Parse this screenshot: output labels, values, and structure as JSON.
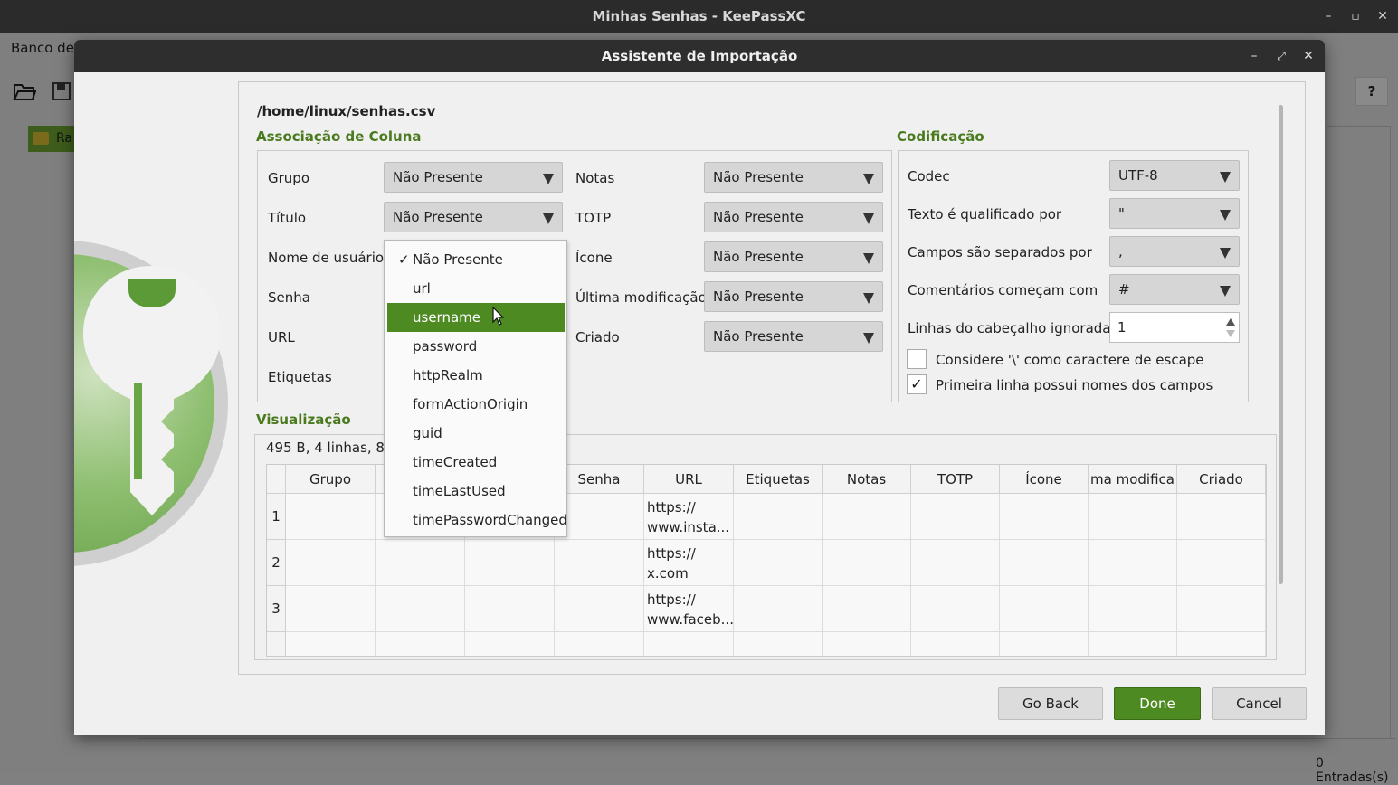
{
  "main_window": {
    "title": "Minhas Senhas - KeePassXC",
    "menu_first": "Banco de",
    "tree_item": "Ra",
    "help": "?",
    "status": "0 Entradas(s)"
  },
  "dialog": {
    "title": "Assistente de Importação",
    "file_path": "/home/linux/senhas.csv",
    "column_section": "Associação de Coluna",
    "encoding_section": "Codificação",
    "preview_section": "Visualização"
  },
  "columns_left": [
    {
      "label": "Grupo",
      "value": "Não Presente"
    },
    {
      "label": "Título",
      "value": "Não Presente"
    },
    {
      "label": "Nome de usuário",
      "value": "Não Presente"
    },
    {
      "label": "Senha",
      "value": ""
    },
    {
      "label": "URL",
      "value": ""
    },
    {
      "label": "Etiquetas",
      "value": ""
    }
  ],
  "columns_right": [
    {
      "label": "Notas",
      "value": "Não Presente"
    },
    {
      "label": "TOTP",
      "value": "Não Presente"
    },
    {
      "label": "Ícone",
      "value": "Não Presente"
    },
    {
      "label": "Última modificação",
      "value": "Não Presente"
    },
    {
      "label": "Criado",
      "value": "Não Presente"
    }
  ],
  "encoding": {
    "codec_label": "Codec",
    "codec_value": "UTF-8",
    "qualifier_label": "Texto é qualificado por",
    "qualifier_value": "\"",
    "separator_label": "Campos são separados por",
    "separator_value": ",",
    "comment_label": "Comentários começam com",
    "comment_value": "#",
    "header_lines_label": "Linhas do cabeçalho ignoradas",
    "header_lines_value": "1",
    "escape_label": "Considere '\\' como caractere de escape",
    "escape_checked": false,
    "firstline_label": "Primeira linha possui nomes dos campos",
    "firstline_checked": true,
    "check_mark": "✓"
  },
  "dropdown": {
    "check": "✓",
    "options": [
      "Não Presente",
      "url",
      "username",
      "password",
      "httpRealm",
      "formActionOrigin",
      "guid",
      "timeCreated",
      "timeLastUsed",
      "timePasswordChanged"
    ],
    "checked_index": 0,
    "highlighted_index": 2
  },
  "preview": {
    "info": "495 B, 4 linhas, 8 c",
    "headers": [
      "Grupo",
      "",
      "",
      "Senha",
      "URL",
      "Etiquetas",
      "Notas",
      "TOTP",
      "Ícone",
      "ma modifica",
      "Criado"
    ],
    "rows": [
      {
        "num": "1",
        "url": [
          "https://",
          "www.insta..."
        ]
      },
      {
        "num": "2",
        "url": [
          "https://",
          "x.com"
        ]
      },
      {
        "num": "3",
        "url": [
          "https://",
          "www.faceb..."
        ]
      },
      {
        "num": "",
        "url": [
          "",
          ""
        ]
      }
    ]
  },
  "buttons": {
    "back": "Go Back",
    "done": "Done",
    "cancel": "Cancel"
  },
  "window_controls": {
    "minimize": "–",
    "maximize": "▫",
    "close": "✕"
  },
  "colors": {
    "accent": "#4e8a22",
    "section_title": "#4a7a1e"
  }
}
